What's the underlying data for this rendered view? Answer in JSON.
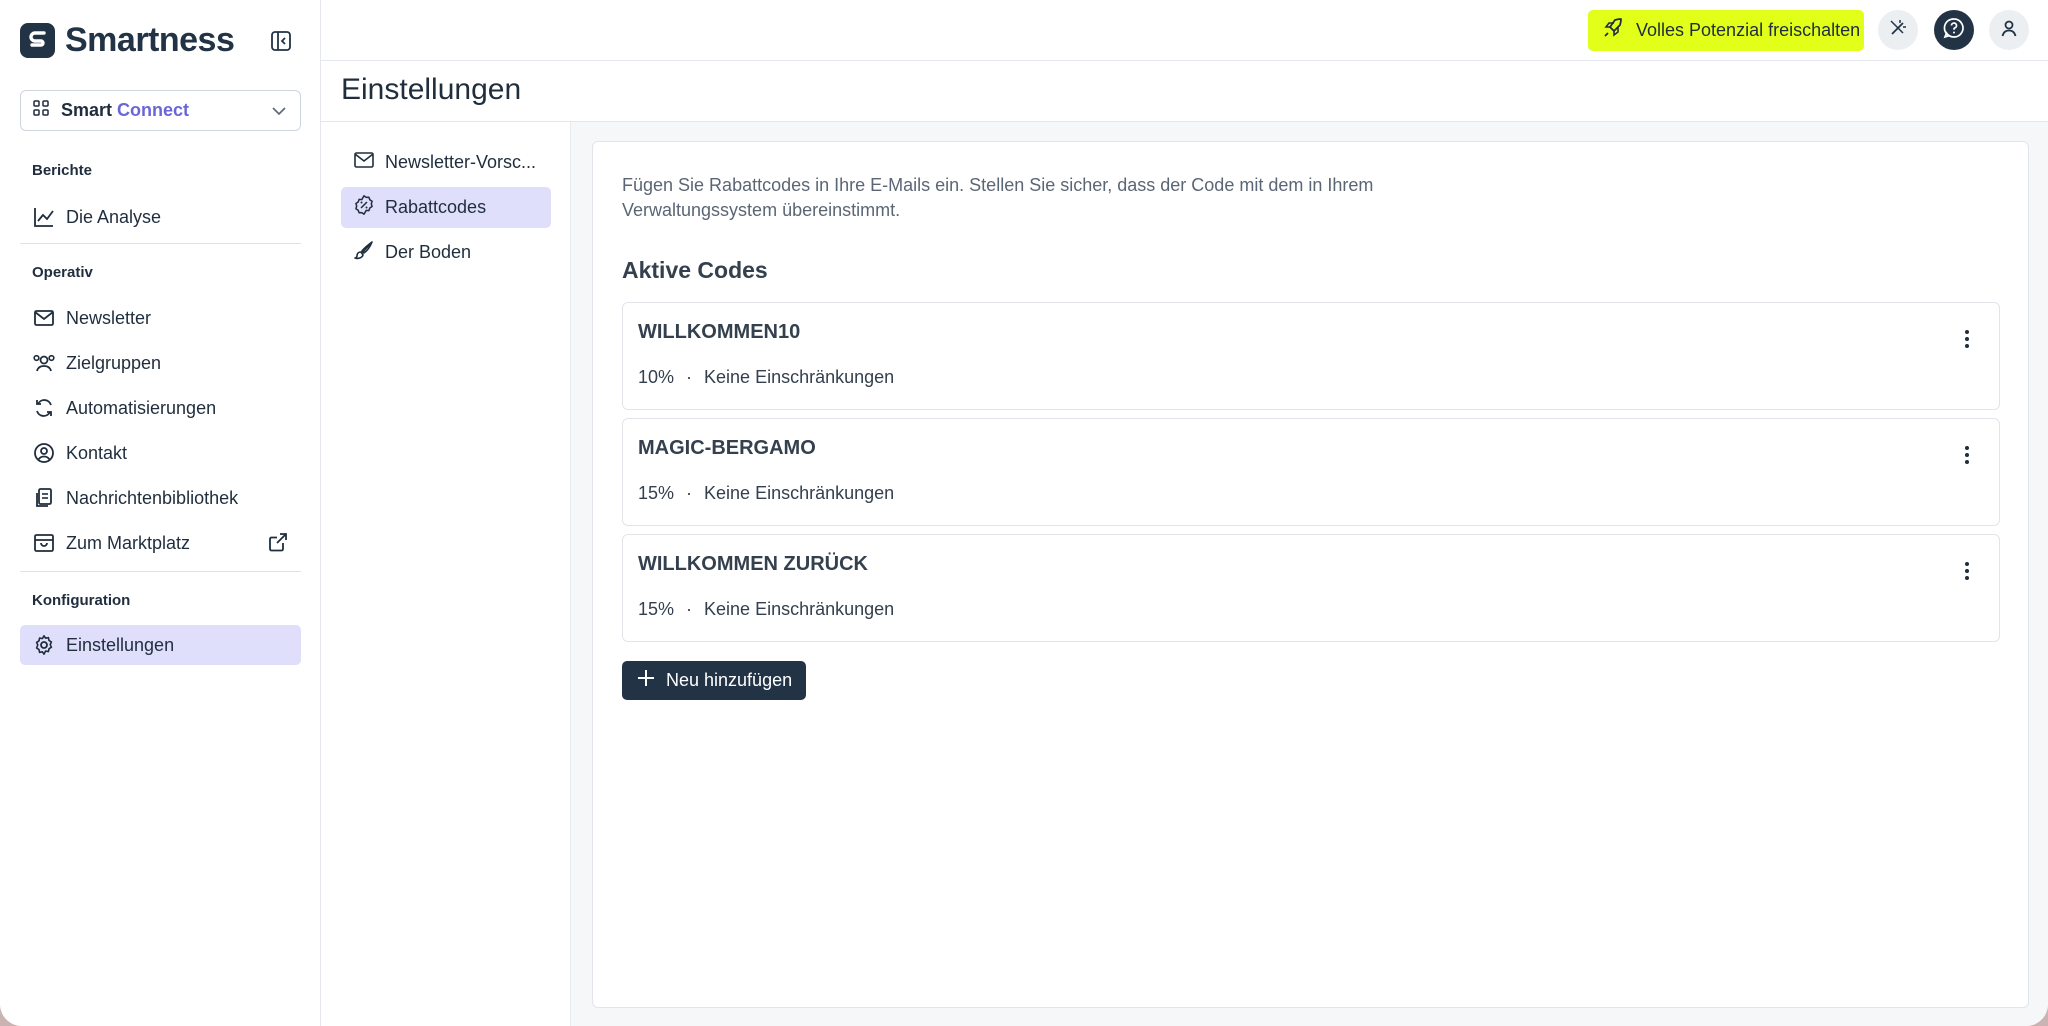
{
  "app": {
    "name": "Smartness",
    "workspace": {
      "name": "Smart",
      "product": "Connect"
    }
  },
  "sidebar": {
    "sections": [
      {
        "label": "Berichte",
        "items": [
          {
            "label": "Die Analyse",
            "icon": "chart-line-icon"
          }
        ]
      },
      {
        "label": "Operativ",
        "items": [
          {
            "label": "Newsletter",
            "icon": "mail-icon"
          },
          {
            "label": "Zielgruppen",
            "icon": "users-icon"
          },
          {
            "label": "Automatisierungen",
            "icon": "refresh-icon"
          },
          {
            "label": "Kontakt",
            "icon": "user-circle-icon"
          },
          {
            "label": "Nachrichtenbibliothek",
            "icon": "files-icon"
          },
          {
            "label": "Zum Marktplatz",
            "icon": "store-icon"
          }
        ]
      },
      {
        "label": "Konfiguration",
        "items": [
          {
            "label": "Einstellungen",
            "icon": "gear-icon",
            "active": true
          }
        ]
      }
    ]
  },
  "topbar": {
    "upgrade_label": "Volles Potenzial freischalten",
    "upgrade_color": "#e2ff1a"
  },
  "page": {
    "title": "Einstellungen"
  },
  "subnav": {
    "items": [
      {
        "label": "Newsletter-Vorsc...",
        "icon": "mail-icon"
      },
      {
        "label": "Rabattcodes",
        "icon": "discount-icon",
        "active": true
      },
      {
        "label": "Der Boden",
        "icon": "brush-icon"
      }
    ]
  },
  "discounts": {
    "description": "Fügen Sie Rabattcodes in Ihre E-Mails ein. Stellen Sie sicher, dass der Code mit dem in Ihrem Verwaltungssystem übereinstimmt.",
    "section_title": "Aktive Codes",
    "codes": [
      {
        "name": "WILLKOMMEN10",
        "percent": "10%",
        "separator": "·",
        "restriction": "Keine Einschränkungen"
      },
      {
        "name": "MAGIC-BERGAMO",
        "percent": "15%",
        "separator": "·",
        "restriction": "Keine Einschränkungen"
      },
      {
        "name": "WILLKOMMEN ZURÜCK",
        "percent": "15%",
        "separator": "·",
        "restriction": "Keine Einschränkungen"
      }
    ],
    "add_label": "Neu hinzufügen"
  },
  "colors": {
    "primary_dark": "#223345",
    "accent_purple": "#6b66d8",
    "active_bg": "#e0dffb"
  }
}
